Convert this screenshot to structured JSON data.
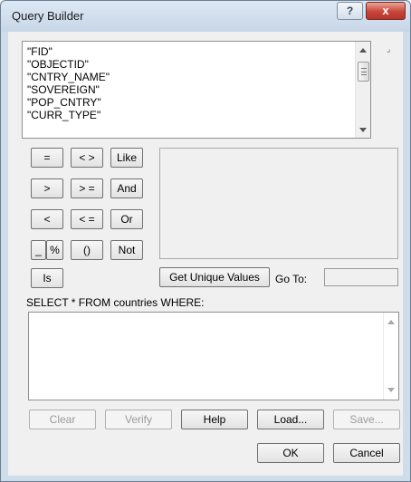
{
  "window": {
    "title": "Query Builder",
    "help_glyph": "?",
    "close_glyph": "x"
  },
  "fields": [
    "\"FID\"",
    "\"OBJECTID\"",
    "\"CNTRY_NAME\"",
    "\"SOVEREIGN\"",
    "\"POP_CNTRY\"",
    "\"CURR_TYPE\""
  ],
  "operators": {
    "equals": "=",
    "not_equal": "< >",
    "like": "Like",
    "greater": ">",
    "greater_equal": "> =",
    "and": "And",
    "less": "<",
    "less_equal": "< =",
    "or": "Or",
    "underscore": "_",
    "percent": "%",
    "parens": "()",
    "not": "Not",
    "is": "Is"
  },
  "unique_values_button": "Get Unique Values",
  "goto_label": "Go To:",
  "goto_value": "",
  "select_prefix": "SELECT * FROM countries WHERE:",
  "sql_expression": "",
  "actions": {
    "clear": "Clear",
    "verify": "Verify",
    "help": "Help",
    "load": "Load...",
    "save": "Save...",
    "ok": "OK",
    "cancel": "Cancel"
  },
  "resize_glyph": "⌟"
}
